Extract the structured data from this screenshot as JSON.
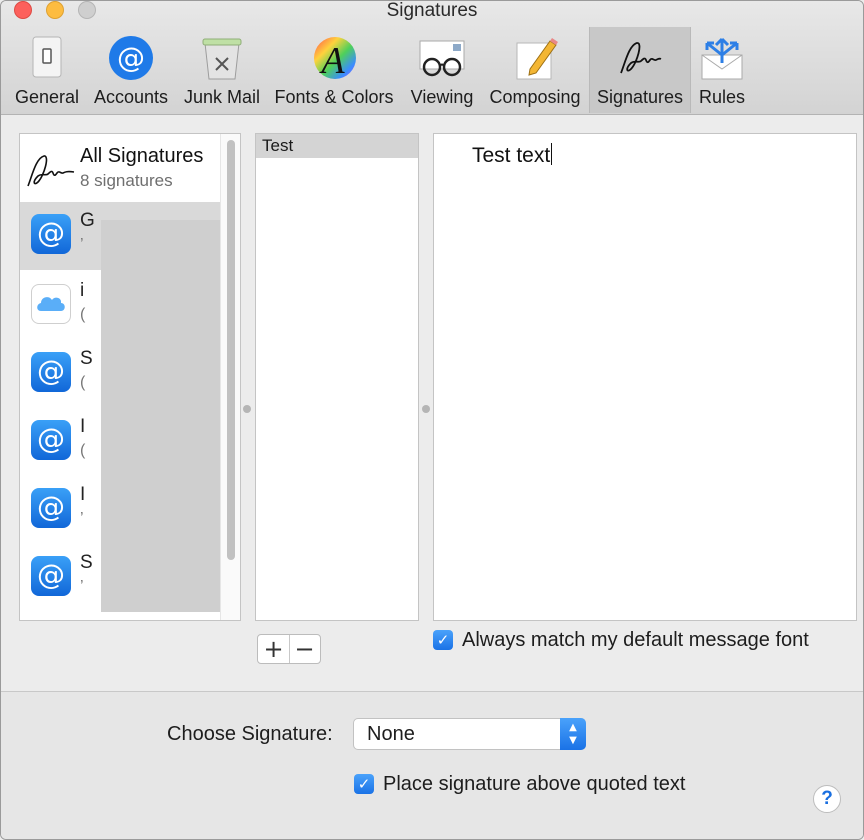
{
  "window": {
    "title": "Signatures"
  },
  "toolbar": {
    "items": [
      {
        "label": "General",
        "icon": "switch-icon"
      },
      {
        "label": "Accounts",
        "icon": "at-icon"
      },
      {
        "label": "Junk Mail",
        "icon": "trash-icon"
      },
      {
        "label": "Fonts & Colors",
        "icon": "fonts-colors-icon"
      },
      {
        "label": "Viewing",
        "icon": "glasses-icon"
      },
      {
        "label": "Composing",
        "icon": "pencil-icon"
      },
      {
        "label": "Signatures",
        "icon": "signature-icon"
      },
      {
        "label": "Rules",
        "icon": "rules-icon"
      }
    ],
    "active": "Signatures"
  },
  "accounts": {
    "all": {
      "title": "All Signatures",
      "subtitle": "8 signatures"
    },
    "rows": [
      {
        "icon": "at-icon",
        "partial": "G",
        "sub": "’"
      },
      {
        "icon": "icloud-icon",
        "partial": "i",
        "sub": "("
      },
      {
        "icon": "at-icon",
        "partial": "S",
        "sub": "("
      },
      {
        "icon": "at-icon",
        "partial": "I",
        "sub": "("
      },
      {
        "icon": "at-icon",
        "partial": "I",
        "sub": "’"
      },
      {
        "icon": "at-icon",
        "partial": "S",
        "sub": "’"
      }
    ]
  },
  "signatures": {
    "items": [
      "Test"
    ]
  },
  "editor": {
    "text": "Test text"
  },
  "buttons": {
    "add": "+",
    "remove": "−",
    "help": "?"
  },
  "options": {
    "match_font": {
      "label": "Always match my default message font",
      "checked": true
    },
    "choose_label": "Choose Signature:",
    "choose_value": "None",
    "place_above": {
      "label": "Place signature above quoted text",
      "checked": true
    }
  },
  "colors": {
    "accent": "#1a72e6",
    "selected_row": "#d9d9d9"
  }
}
